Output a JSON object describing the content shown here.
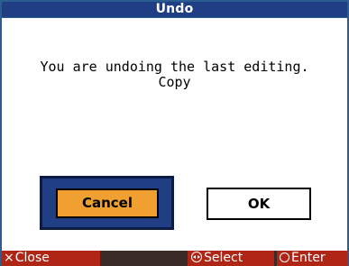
{
  "dialog": {
    "title": "Undo",
    "message_line1": "You are undoing the last editing.",
    "message_line2": "Copy",
    "cancel_label": "Cancel",
    "ok_label": "OK"
  },
  "footer": {
    "close_icon": "×",
    "close_label": "Close",
    "select_label": "Select",
    "enter_label": "Enter"
  },
  "colors": {
    "title_bar": "#1f3e83",
    "cancel_selected": "#f0a030",
    "footer_button": "#b02616"
  },
  "icons": {
    "close": "x-icon",
    "select": "dial-left-right-icon",
    "enter": "circle-icon"
  }
}
